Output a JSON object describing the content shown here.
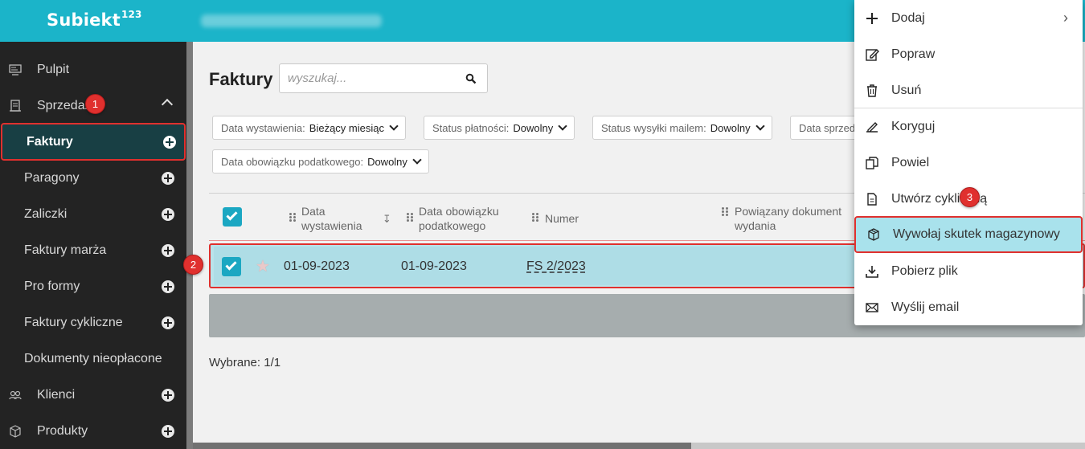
{
  "app": {
    "logo_text": "Subiekt",
    "logo_suffix": "123"
  },
  "sidebar": {
    "items": [
      {
        "label": "Pulpit",
        "icon": "monitor-icon"
      },
      {
        "label": "Sprzedaż",
        "icon": "receipt-icon",
        "expanded": true
      },
      {
        "label": "Faktury",
        "active": true
      },
      {
        "label": "Paragony"
      },
      {
        "label": "Zaliczki"
      },
      {
        "label": "Faktury marża"
      },
      {
        "label": "Pro formy"
      },
      {
        "label": "Faktury cykliczne"
      },
      {
        "label": "Dokumenty nieopłacone"
      },
      {
        "label": "Klienci",
        "icon": "users-icon"
      },
      {
        "label": "Produkty",
        "icon": "box-icon"
      }
    ]
  },
  "main": {
    "title": "Faktury",
    "search_placeholder": "wyszukaj...",
    "filters": [
      {
        "label": "Data wystawienia:",
        "value": "Bieżący miesiąc"
      },
      {
        "label": "Status płatności:",
        "value": "Dowolny"
      },
      {
        "label": "Status wysyłki mailem:",
        "value": "Dowolny"
      },
      {
        "label": "Data sprzedaży:",
        "value": ""
      },
      {
        "label": "Data obowiązku podatkowego:",
        "value": "Dowolny"
      }
    ],
    "columns": [
      {
        "line1": "Data",
        "line2": "wystawienia"
      },
      {
        "line1": "Data obowiązku",
        "line2": "podatkowego"
      },
      {
        "line1": "Numer",
        "line2": ""
      },
      {
        "line1": "Powiązany dokument",
        "line2": "wydania"
      }
    ],
    "rows": [
      {
        "checked": true,
        "issue_date": "01-09-2023",
        "tax_date": "01-09-2023",
        "number": "FS 2/2023"
      }
    ],
    "selected_text": "Wybrane: 1/1"
  },
  "context_menu": {
    "items": [
      {
        "label": "Dodaj",
        "icon": "plus-icon",
        "submenu": true
      },
      {
        "label": "Popraw",
        "icon": "edit-icon"
      },
      {
        "label": "Usuń",
        "icon": "trash-icon"
      },
      {
        "label": "Koryguj",
        "icon": "correct-icon"
      },
      {
        "label": "Powiel",
        "icon": "duplicate-icon"
      },
      {
        "label": "Utwórz cykliczną",
        "icon": "document-icon"
      },
      {
        "label": "Wywołaj skutek magazynowy",
        "icon": "package-icon",
        "highlighted": true
      },
      {
        "label": "Pobierz plik",
        "icon": "download-icon"
      },
      {
        "label": "Wyślij email",
        "icon": "mail-icon"
      }
    ]
  },
  "markers": [
    "1",
    "2",
    "3"
  ],
  "colors": {
    "topbar": "#1bb4c9",
    "sidebar": "#232323",
    "active_item": "#183f44",
    "highlight": "#a9e2ec",
    "marker": "#e0302e",
    "checkbox": "#1ba7c2"
  }
}
